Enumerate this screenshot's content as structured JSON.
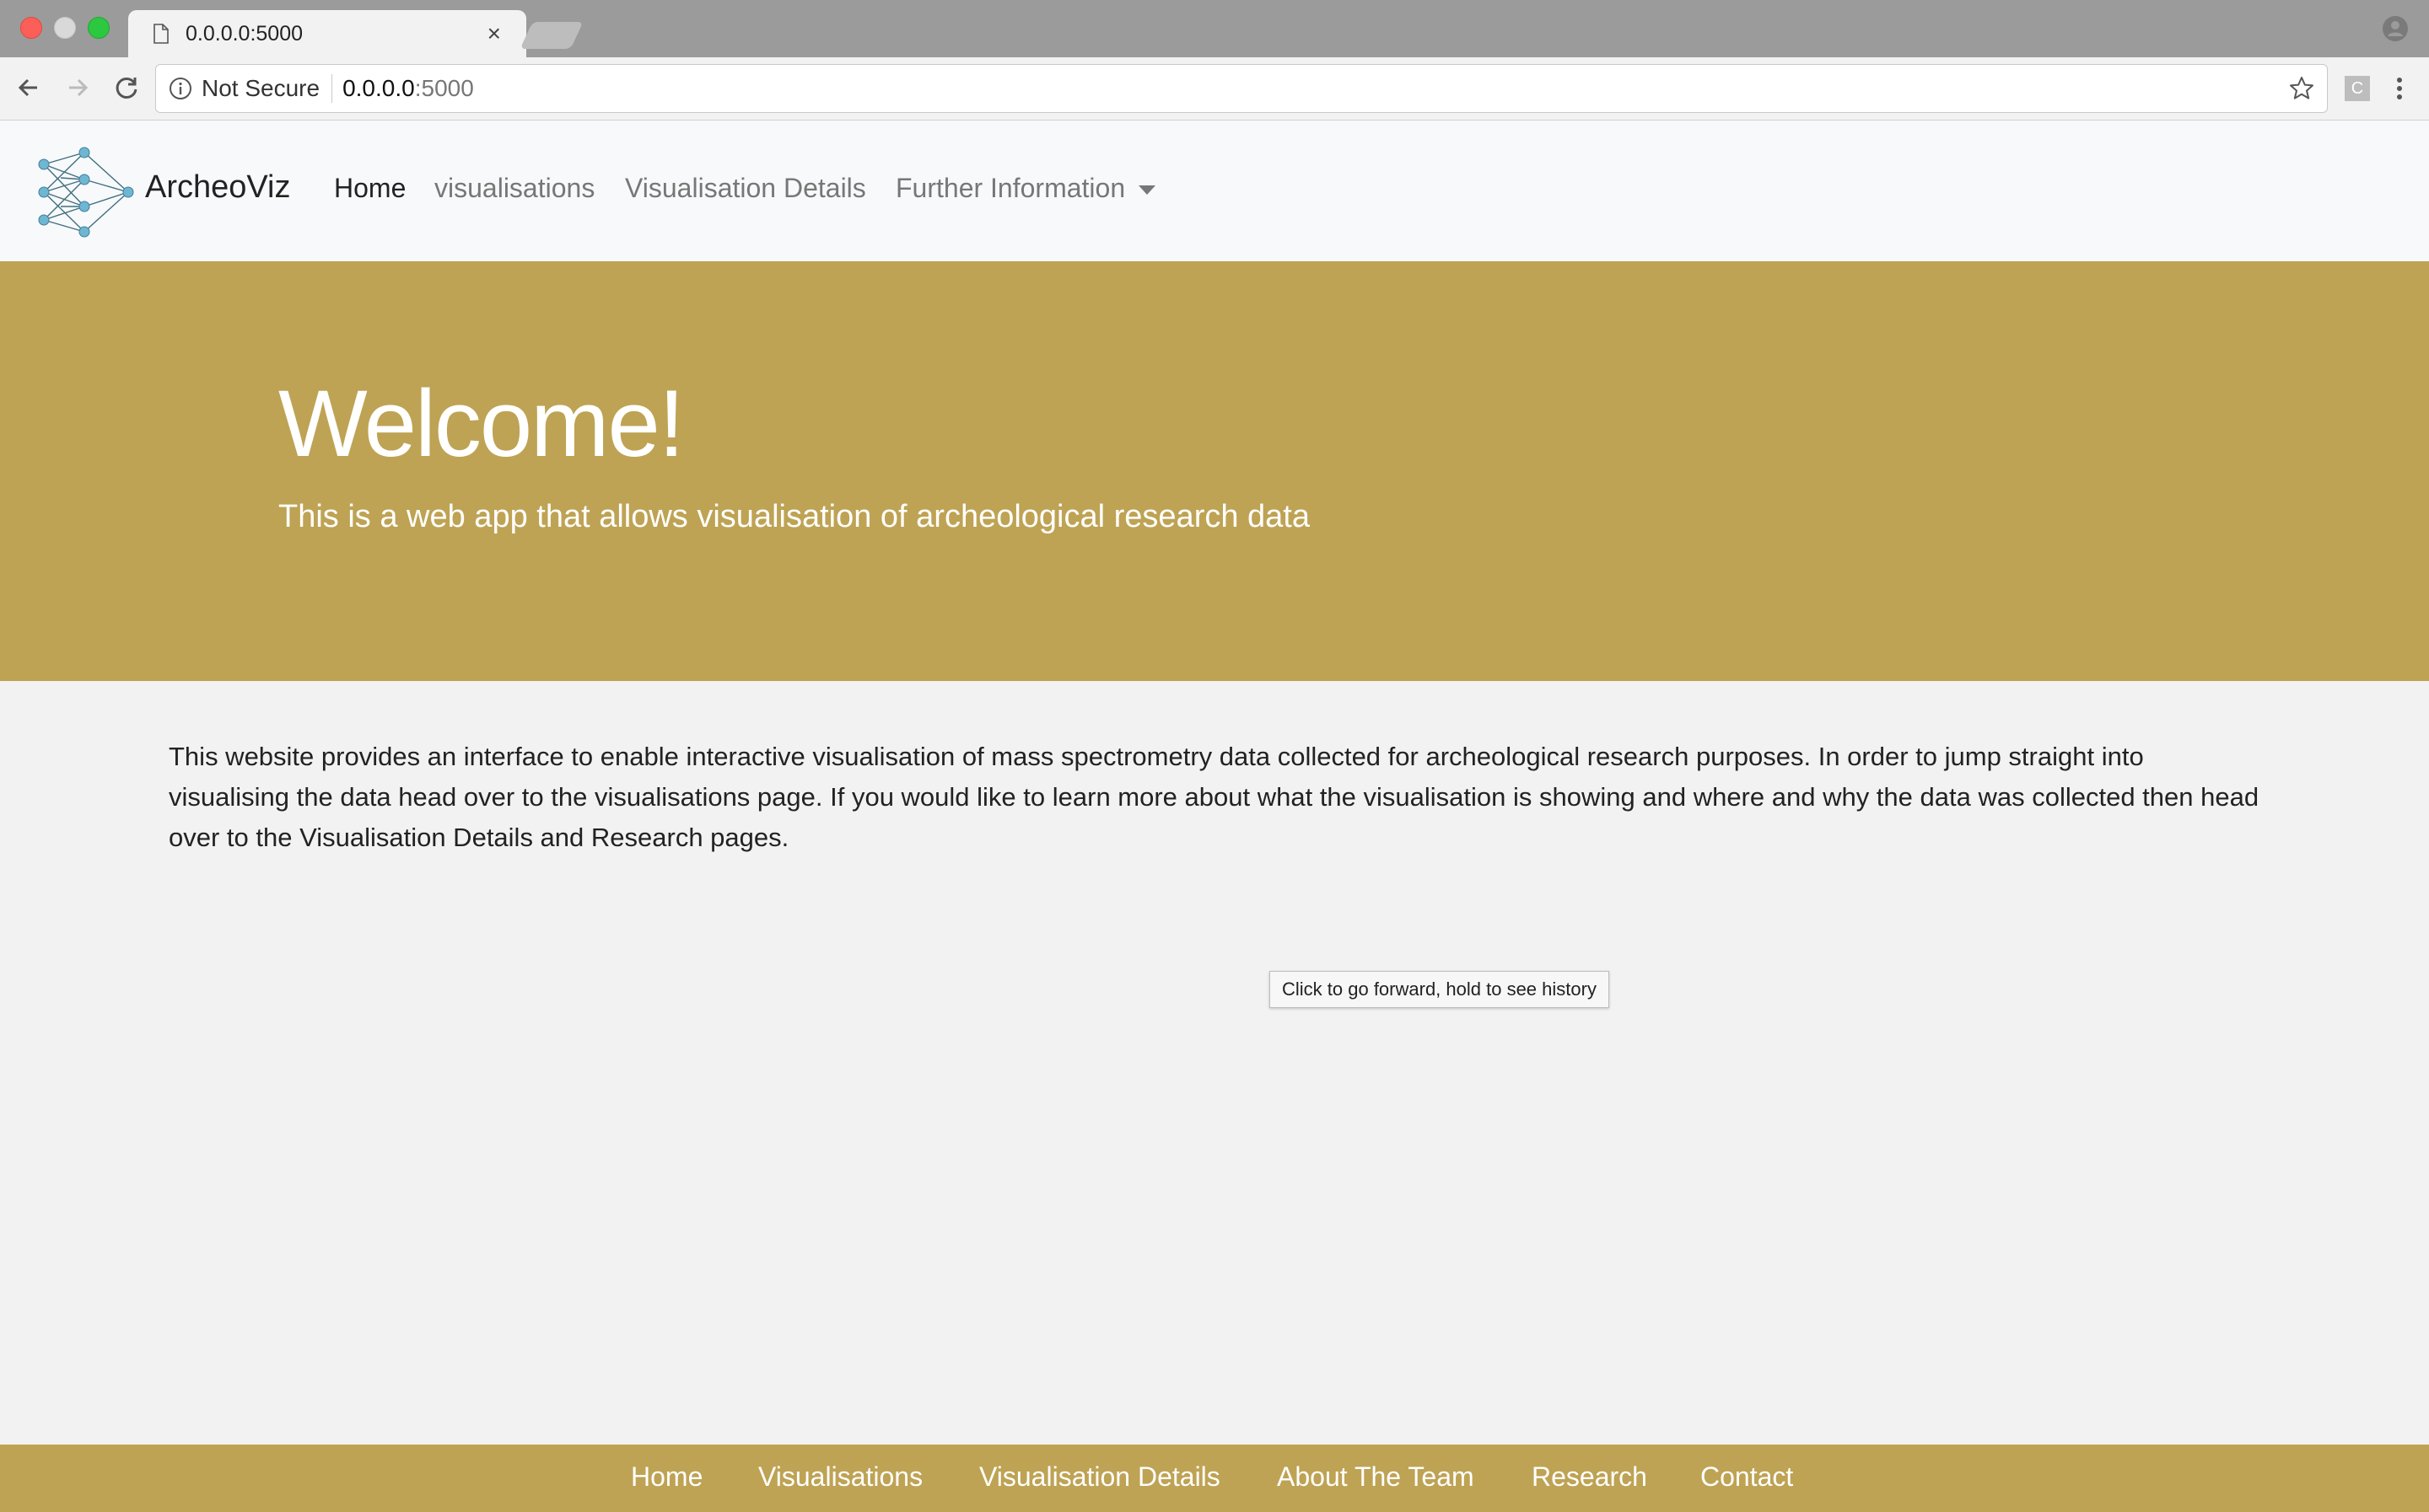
{
  "browser": {
    "tab_title": "0.0.0.0:5000",
    "close_glyph": "×",
    "security_label": "Not Secure",
    "url_host": "0.0.0.0",
    "url_port": ":5000",
    "extension_letter": "C"
  },
  "site": {
    "brand": "ArcheoViz",
    "nav": {
      "home": "Home",
      "visualisations": "visualisations",
      "details": "Visualisation Details",
      "further": "Further Information"
    },
    "hero": {
      "title": "Welcome!",
      "subtitle": "This is a web app that allows visualisation of archeological research data"
    },
    "intro": "This website provides an interface to enable interactive visualisation of mass spectrometry data collected for archeological research purposes. In order to jump straight into visualising the data head over to the visualisations page. If you would like to learn more about what the visualisation is showing and where and why the data was collected then head over to the Visualisation Details and Research pages.",
    "tooltip": "Click to go forward, hold to see history",
    "footer": {
      "home": "Home",
      "visualisations": "Visualisations",
      "details": "Visualisation Details",
      "team": "About The Team",
      "research": "Research",
      "contact": "Contact"
    }
  },
  "colors": {
    "accent": "#bea354",
    "navbar_bg": "#f8f9fa",
    "page_bg": "#f2f2f2"
  }
}
